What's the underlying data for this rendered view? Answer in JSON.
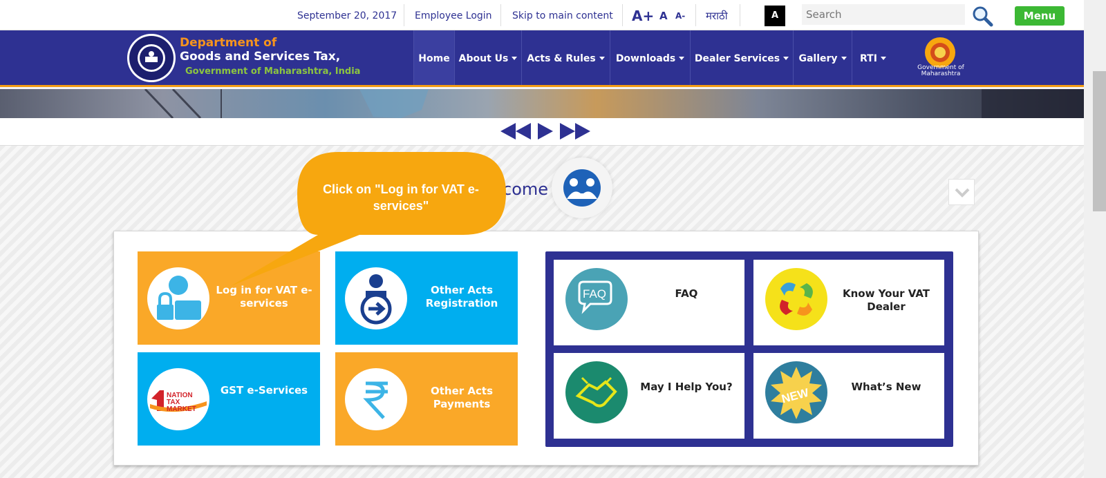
{
  "topbar": {
    "date": "September 20, 2017",
    "employee_login": "Employee Login",
    "skip_link": "Skip to main content",
    "font_increase": "A+",
    "font_normal": "A",
    "font_decrease": "A-",
    "language": "मराठी",
    "contrast": "A",
    "search_placeholder": "Search",
    "menu": "Menu"
  },
  "header": {
    "dept_line1": "Department of",
    "dept_line2": "Goods and Services Tax,",
    "dept_line3": "Government of Maharashtra, India",
    "gov_text": "Government of Maharashtra"
  },
  "nav": {
    "items": [
      {
        "label": "Home"
      },
      {
        "label": "About Us"
      },
      {
        "label": "Acts & Rules"
      },
      {
        "label": "Downloads"
      },
      {
        "label": "Dealer Services"
      },
      {
        "label": "Gallery"
      },
      {
        "label": "RTI"
      }
    ]
  },
  "main": {
    "welcome": "come",
    "callout": "Click on \"Log in for VAT e-services\"",
    "tiles": [
      {
        "label": "Log in for VAT e-services",
        "icon": "login-user-icon"
      },
      {
        "label": "Other Acts Registration",
        "icon": "registration-icon"
      },
      {
        "label": "GST e-Services",
        "icon": "one-nation-tax-market-icon"
      },
      {
        "label": "Other Acts Payments",
        "icon": "rupee-icon"
      }
    ],
    "widgets": [
      {
        "label": "FAQ",
        "icon_text": "FAQ"
      },
      {
        "label": "Know Your VAT Dealer"
      },
      {
        "label": "May I Help You?"
      },
      {
        "label": "What’s New",
        "icon_text": "NEW"
      }
    ],
    "logo_text": {
      "nation": "NATION",
      "tax": "TAX",
      "market": "MARKET"
    }
  },
  "colors": {
    "navy": "#2e3192",
    "orange": "#faa828",
    "cyan": "#00aeef",
    "callout": "#f7a70f",
    "menu_green": "#3cb834"
  }
}
